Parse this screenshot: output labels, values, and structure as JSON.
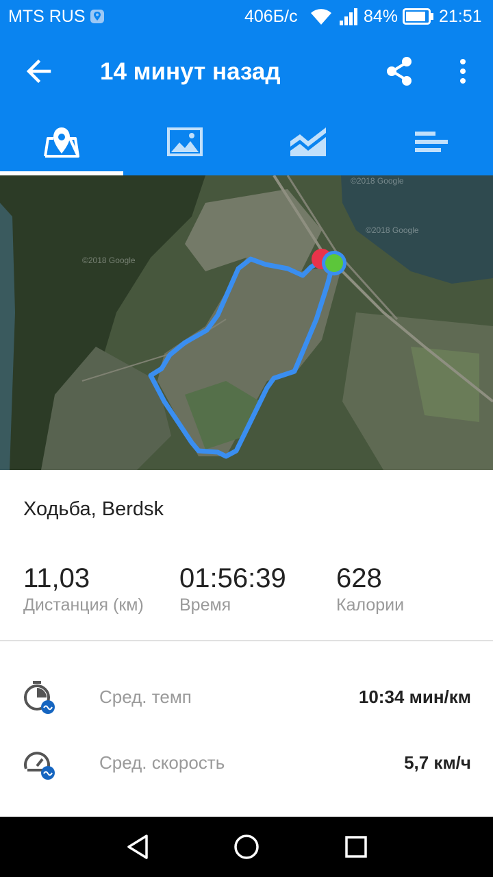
{
  "status_bar": {
    "carrier": "MTS RUS",
    "net_speed": "406Б/с",
    "battery": "84%",
    "time": "21:51"
  },
  "app_bar": {
    "title": "14 минут назад",
    "tabs": [
      {
        "name": "map",
        "icon": "map-pin-icon",
        "selected": true
      },
      {
        "name": "photos",
        "icon": "image-icon",
        "selected": false
      },
      {
        "name": "charts",
        "icon": "area-chart-icon",
        "selected": false
      },
      {
        "name": "laps",
        "icon": "bars-icon",
        "selected": false
      }
    ]
  },
  "map": {
    "watermark": "©2018 Google",
    "route_color": "#3a8ef0",
    "start_color": "#e8334a",
    "end_color": "#5cc63a"
  },
  "activity": {
    "title": "Ходьба, Berdsk"
  },
  "stats": [
    {
      "value": "11,03",
      "label": "Дистанция (км)"
    },
    {
      "value": "01:56:39",
      "label": "Время"
    },
    {
      "value": "628",
      "label": "Калории"
    }
  ],
  "details": [
    {
      "icon": "stopwatch-avg-icon",
      "label": "Сред. темп",
      "value": "10:34 мин/км"
    },
    {
      "icon": "speedometer-avg-icon",
      "label": "Сред. скорость",
      "value": "5,7 км/ч"
    }
  ],
  "colors": {
    "primary": "#0a84f0",
    "accent_badge": "#1565c0"
  }
}
